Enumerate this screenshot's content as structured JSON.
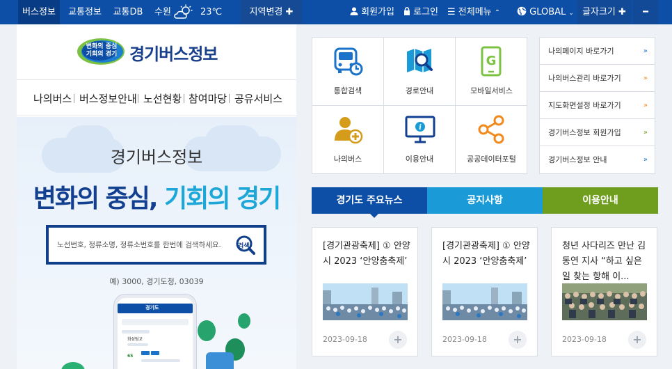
{
  "topbar": {
    "tabs": [
      "버스정보",
      "교통정보",
      "교통DB"
    ],
    "weather": {
      "city": "수원",
      "temp": "23℃"
    },
    "region_button": "지역변경",
    "join": "회원가입",
    "login": "로그인",
    "all_menu": "전체메뉴",
    "global": "GLOBAL",
    "font_size": "글자크기"
  },
  "logo": {
    "badge_line1": "변화의 중심",
    "badge_line2": "기회의 경기",
    "title": "경기버스정보"
  },
  "nav": [
    "나의버스",
    "버스정보안내",
    "노선현황",
    "참여마당",
    "공유서비스"
  ],
  "hero": {
    "title": "경기버스정보",
    "slogan_part1": "변화의 중심,",
    "slogan_part2": "기회의 경기",
    "search_placeholder": "노선번호, 정류소명, 정류소번호를 한번에 검색하세요.",
    "search_button": "검색",
    "example": "예) 3000, 경기도청, 03039"
  },
  "phone": {
    "header": "경기도",
    "route": "화성팀교",
    "number": "65"
  },
  "quick_menu": [
    {
      "label": "통합검색",
      "icon": "bus-search-icon"
    },
    {
      "label": "경로안내",
      "icon": "map-search-icon"
    },
    {
      "label": "모바일서비스",
      "icon": "mobile-icon"
    },
    {
      "label": "나의버스",
      "icon": "user-add-icon"
    },
    {
      "label": "이용안내",
      "icon": "info-monitor-icon"
    },
    {
      "label": "공공데이터포털",
      "icon": "share-icon"
    }
  ],
  "quick_links": [
    "나의페이지 바로가기",
    "나의버스관리 바로가기",
    "지도화면설정 바로가기",
    "경기버스정보 회원가입",
    "경기버스정보 안내"
  ],
  "tabs": [
    "경기도 주요뉴스",
    "공지사항",
    "이용안내"
  ],
  "colors": {
    "primary": "#0d4fa6",
    "sky": "#1a9bd7",
    "green": "#6f9e1e",
    "icon_blue": "#1a73c8",
    "icon_green": "#7cc242",
    "icon_orange": "#f08a1c",
    "icon_gold": "#d59c1c"
  },
  "news": [
    {
      "title": "[경기관광축제] ① 안양시 2023 ‘안양춤축제’",
      "date": "2023-09-18"
    },
    {
      "title": "[경기관광축제] ① 안양시 2023 ‘안양춤축제’",
      "date": "2023-09-18"
    },
    {
      "title": "청년 사다리즈 만난 김동연 지사 “하고 싶은 일 찾는 항해 이...",
      "date": "2023-09-18"
    }
  ]
}
